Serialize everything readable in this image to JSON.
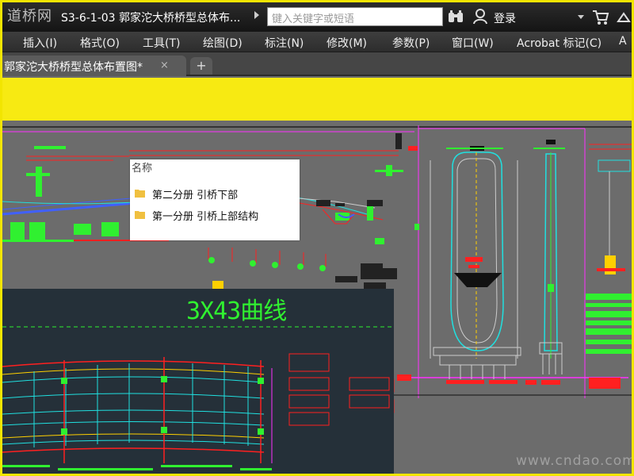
{
  "titlebar": {
    "logo": "道桥网",
    "doc_title": "S3-6-1-03 郭家沱大桥桥型总体布...",
    "search_placeholder": "键入关键字或短语",
    "login_label": "登录",
    "icons": [
      "binoculars-icon",
      "user-icon",
      "chevron-down-icon",
      "cart-icon",
      "help-icon"
    ]
  },
  "menu": {
    "items": [
      "插入(I)",
      "格式(O)",
      "工具(T)",
      "绘图(D)",
      "标注(N)",
      "修改(M)",
      "参数(P)",
      "窗口(W)",
      "Acrobat 标记(C)",
      "A"
    ]
  },
  "tabs": {
    "active_label": "郭家沱大桥桥型总体布置图*",
    "close_glyph": "×",
    "add_glyph": "+"
  },
  "popup": {
    "header": "名称",
    "items": [
      "第二分册 引桥下部",
      "第一分册 引桥上部结构"
    ]
  },
  "drawing": {
    "curve_title": "3X43曲线",
    "watermark": "www.cndao.com"
  },
  "colors": {
    "frame_yellow": "#f2e500",
    "cad_background": "#6c6c6c",
    "dark_panel": "#253039",
    "green": "#30f030",
    "red": "#ff2020",
    "cyan": "#20e0e0",
    "magenta": "#ff30ff"
  }
}
